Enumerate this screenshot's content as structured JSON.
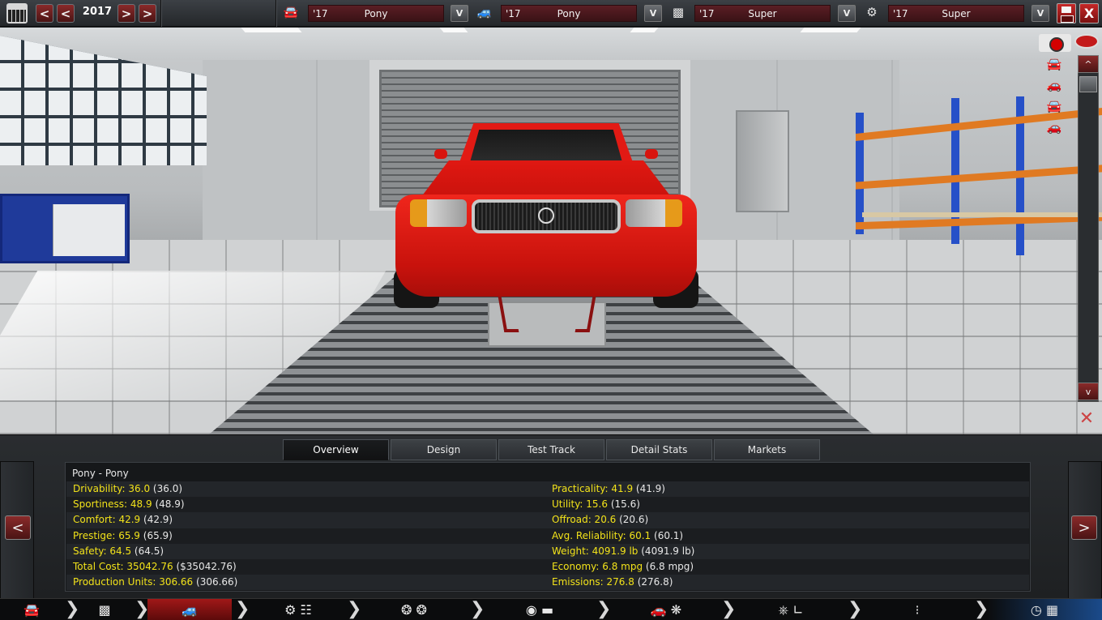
{
  "topbar": {
    "year": "2017",
    "prev_fast": "<",
    "prev": "<",
    "next": ">",
    "next_fast": ">",
    "slots": [
      {
        "icon": "car-side-icon",
        "year": "'17",
        "name": "Pony"
      },
      {
        "icon": "car-model-icon",
        "year": "'17",
        "name": "Pony"
      },
      {
        "icon": "chassis-icon",
        "year": "'17",
        "name": "Super"
      },
      {
        "icon": "engine-icon",
        "year": "'17",
        "name": "Super"
      }
    ],
    "dropdown_label": "V",
    "close_label": "X"
  },
  "viewport": {
    "scroll_up": "^",
    "scroll_down": "v",
    "view_icons": [
      "car-front-icon",
      "car-side-view-icon",
      "car-rear-icon",
      "car-top-icon"
    ]
  },
  "panel": {
    "tabs": [
      "Overview",
      "Design",
      "Test Track",
      "Detail Stats",
      "Markets"
    ],
    "active_tab": 0,
    "car_title": "Pony - Pony",
    "stats_left": [
      {
        "label": "Drivability: 36.0",
        "paren": "(36.0)"
      },
      {
        "label": "Sportiness: 48.9",
        "paren": "(48.9)"
      },
      {
        "label": "Comfort: 42.9",
        "paren": "(42.9)"
      },
      {
        "label": "Prestige: 65.9",
        "paren": "(65.9)"
      },
      {
        "label": "Safety: 64.5",
        "paren": "(64.5)"
      },
      {
        "label": "Total Cost: 35042.76",
        "paren": "($35042.76)"
      },
      {
        "label": "Production Units: 306.66",
        "paren": "(306.66)"
      }
    ],
    "stats_right": [
      {
        "label": "Practicality: 41.9",
        "paren": "(41.9)"
      },
      {
        "label": "Utility: 15.6",
        "paren": "(15.6)"
      },
      {
        "label": "Offroad: 20.6",
        "paren": "(20.6)"
      },
      {
        "label": "Avg. Reliability: 60.1",
        "paren": "(60.1)"
      },
      {
        "label": "Weight: 4091.9 lb",
        "paren": "(4091.9 lb)"
      },
      {
        "label": "Economy: 6.8 mpg",
        "paren": "(6.8 mpg)"
      },
      {
        "label": "Emissions: 276.8",
        "paren": "(276.8)"
      }
    ],
    "prev_label": "<",
    "next_label": ">"
  },
  "bottom_nav": {
    "steps": [
      "car-model-step-icon",
      "chassis-step-icon",
      "car-design-step-icon",
      "engine-gearbox-step-icon",
      "wheels-step-icon",
      "body-step-icon",
      "aero-cooling-step-icon",
      "interior-step-icon",
      "suspension-step-icon",
      "test-finish-step-icon"
    ],
    "active_step": 2
  },
  "colors": {
    "accent_red": "#8a2a2a",
    "stat_label": "#f2e21a",
    "car_red": "#e21a14"
  }
}
